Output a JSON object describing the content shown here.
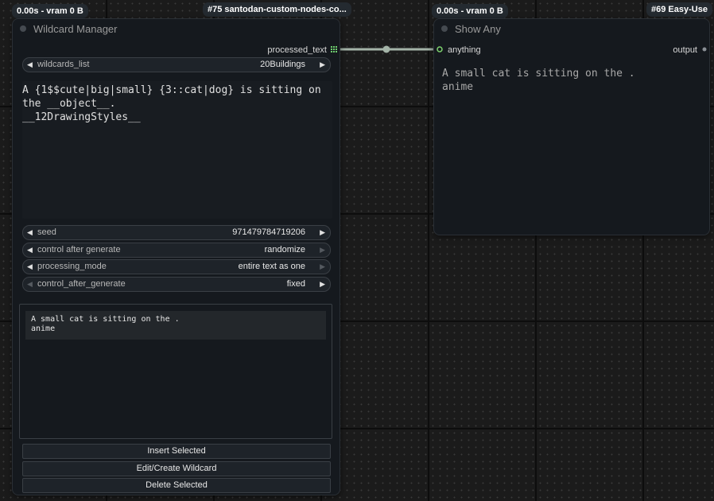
{
  "badges": {
    "left_timing": "0.00s - vram 0 B",
    "left_node_id": "#75 santodan-custom-nodes-co...",
    "right_timing": "0.00s - vram 0 B",
    "right_node_id": "#69 Easy-Use"
  },
  "wildcard_node": {
    "title": "Wildcard Manager",
    "output_label": "processed_text",
    "wildcards_list": {
      "label": "wildcards_list",
      "value": "20Buildings"
    },
    "prompt_text": "A {1$$cute|big|small} {3::cat|dog} is sitting on\nthe __object__.\n__12DrawingStyles__",
    "seed": {
      "label": "seed",
      "value": "971479784719206"
    },
    "control_after_generate_1": {
      "label": "control after generate",
      "value": "randomize"
    },
    "processing_mode": {
      "label": "processing_mode",
      "value": "entire text as one"
    },
    "control_after_generate_2": {
      "label": "control_after_generate",
      "value": "fixed"
    },
    "preview_text": "A small cat is sitting on the .\nanime",
    "buttons": {
      "insert": "Insert Selected",
      "edit_create": "Edit/Create Wildcard",
      "delete": "Delete Selected"
    }
  },
  "show_any_node": {
    "title": "Show Any",
    "input_label": "anything",
    "output_label": "output",
    "display_text": "A small cat is sitting on the .\nanime"
  },
  "colors": {
    "link": "#a4b4a8",
    "input_slot": "#7ed36e",
    "grid_output_slot": "#6fcf6f"
  }
}
